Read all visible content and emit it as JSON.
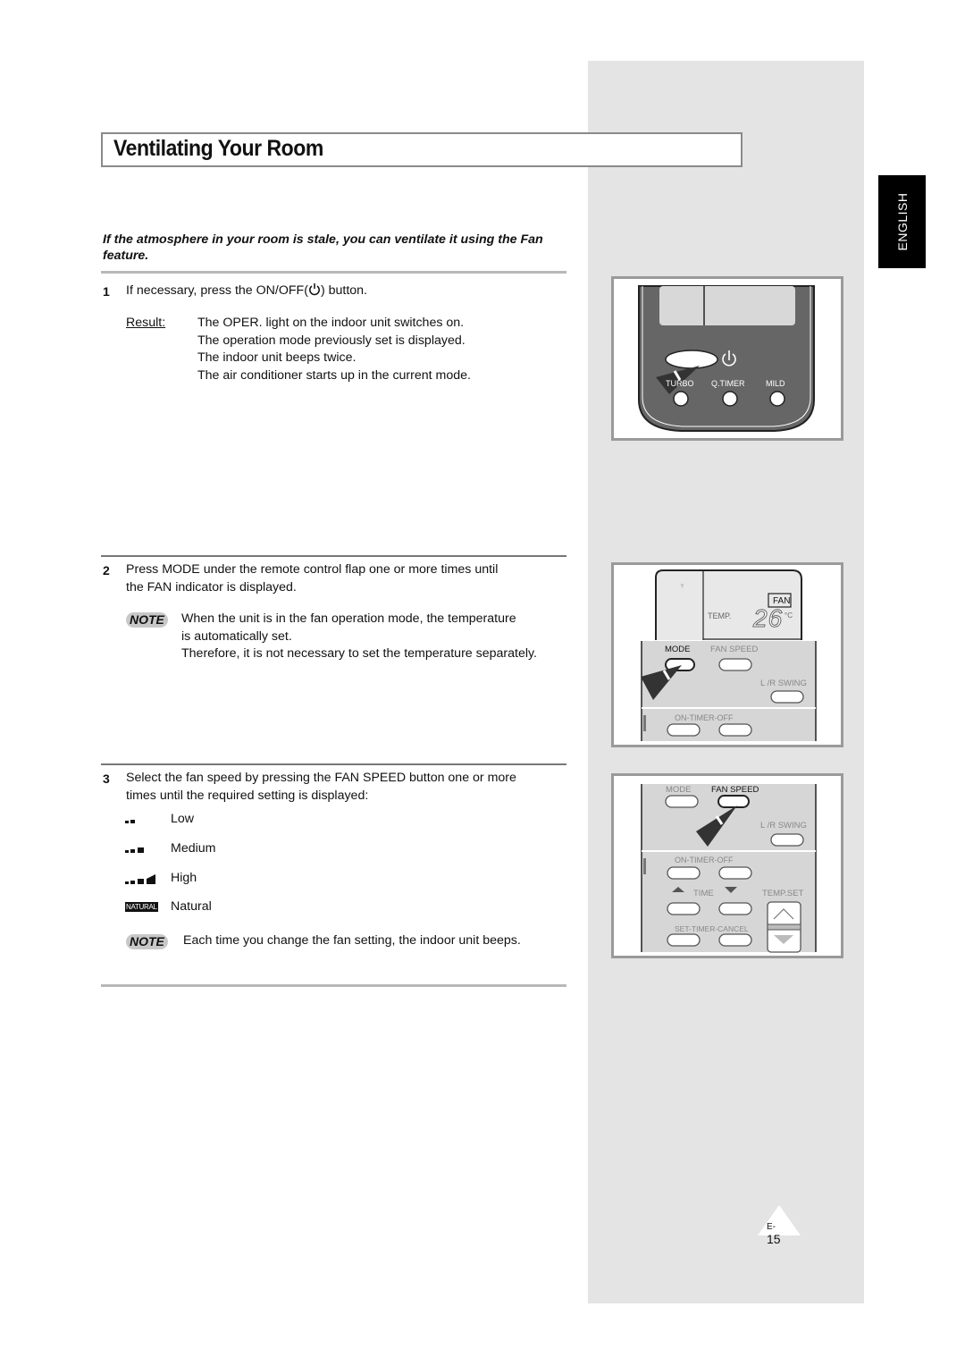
{
  "page": {
    "title": "Ventilating Your Room",
    "language_tab": "ENGLISH",
    "page_number_prefix": "E-",
    "page_number": "15"
  },
  "intro": "If the atmosphere in your room is stale, you can ventilate it using the Fan feature.",
  "steps": [
    {
      "number": "1",
      "text_before": "If necessary, press the ON/OFF(",
      "icon": "power-icon",
      "text_after": ") button.",
      "result_label": "Result:",
      "result_lines": [
        "The OPER. light on the indoor unit switches on.",
        "The operation mode previously set is displayed.",
        "The indoor unit beeps twice.",
        "The air conditioner starts up in the current mode."
      ]
    },
    {
      "number": "2",
      "lines": [
        "Press MODE under the remote control flap one or more times until",
        "the FAN indicator is displayed."
      ],
      "note_label": "NOTE",
      "note_lines": [
        "When the unit is in the fan operation mode, the temperature",
        "is automatically set.",
        "Therefore, it is not necessary to set the temperature separately."
      ]
    },
    {
      "number": "3",
      "lines": [
        "Select the fan speed by pressing the FAN SPEED button one or more",
        "times until the required setting is displayed:"
      ],
      "fan_speeds": [
        {
          "icon": "fan-speed-low-icon",
          "label": "Low"
        },
        {
          "icon": "fan-speed-medium-icon",
          "label": "Medium"
        },
        {
          "icon": "fan-speed-high-icon",
          "label": "High"
        },
        {
          "icon": "fan-speed-natural-icon",
          "label": "Natural",
          "badge": "NATURAL"
        }
      ],
      "note_label": "NOTE",
      "note_text": "Each time you change the fan setting, the indoor unit beeps."
    }
  ],
  "figures": {
    "fig1": {
      "buttons": [
        "TURBO",
        "Q.TIMER",
        "MILD"
      ]
    },
    "fig2": {
      "display_mode": "FAN",
      "temp_label": "TEMP.",
      "temp_value": "26",
      "temp_unit": "°C",
      "mode_label": "MODE",
      "fan_speed_label": "FAN SPEED",
      "swing_label": "L /R SWING",
      "timer_label": "ON-TIMER-OFF"
    },
    "fig3": {
      "mode_label": "MODE",
      "fan_speed_label": "FAN SPEED",
      "swing_label": "L /R SWING",
      "timer_label": "ON-TIMER-OFF",
      "time_label": "TIME",
      "temp_set_label": "TEMP.SET",
      "set_timer_label": "SET-TIMER-CANCEL"
    }
  }
}
